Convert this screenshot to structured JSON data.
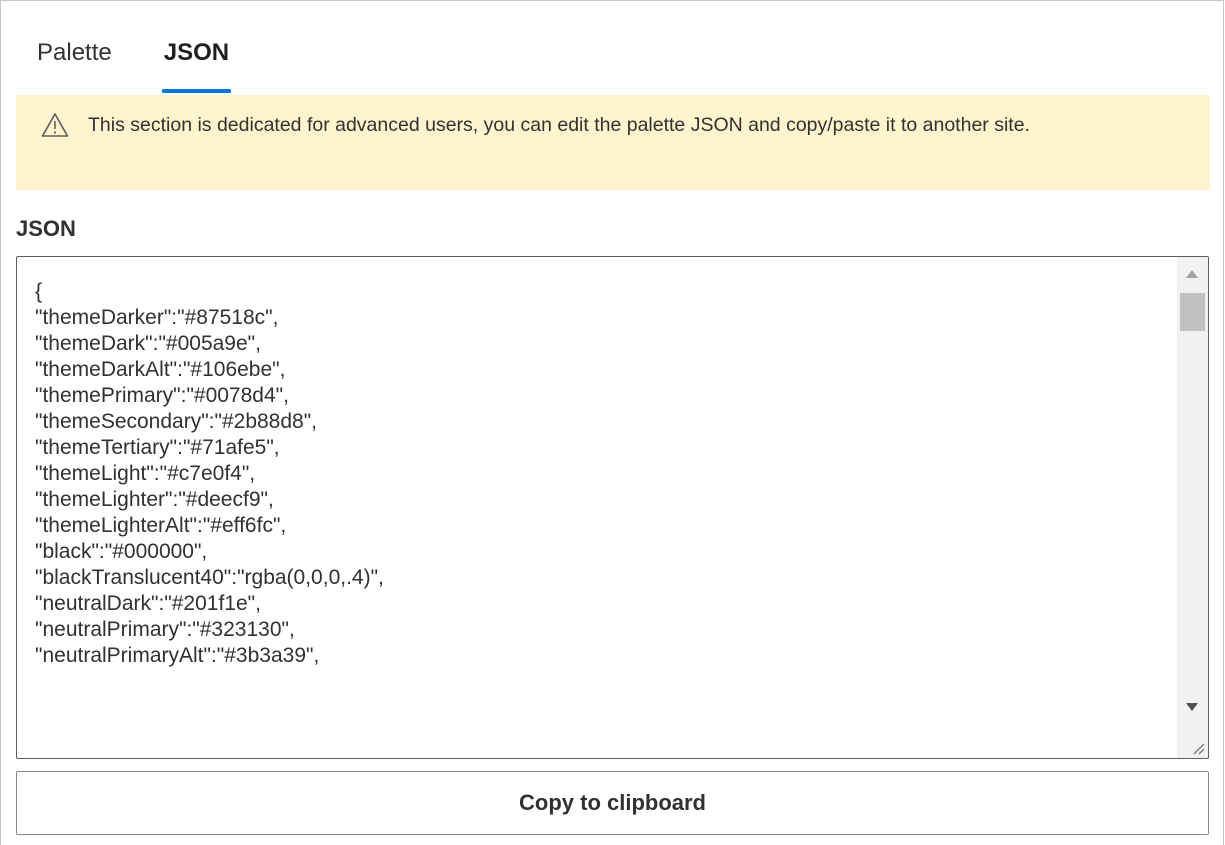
{
  "tabs": [
    {
      "label": "Palette",
      "active": false
    },
    {
      "label": "JSON",
      "active": true
    }
  ],
  "colors": {
    "accent": "#0078d4",
    "warning_bg": "#fff4ce",
    "text": "#323130"
  },
  "warning": {
    "icon": "warning-triangle-icon",
    "text": "This section is dedicated for advanced users, you can edit the palette JSON and copy/paste it to another site."
  },
  "json_field": {
    "label": "JSON",
    "value": "{\n\"themeDarker\":\"#87518c\",\n\"themeDark\":\"#005a9e\",\n\"themeDarkAlt\":\"#106ebe\",\n\"themePrimary\":\"#0078d4\",\n\"themeSecondary\":\"#2b88d8\",\n\"themeTertiary\":\"#71afe5\",\n\"themeLight\":\"#c7e0f4\",\n\"themeLighter\":\"#deecf9\",\n\"themeLighterAlt\":\"#eff6fc\",\n\"black\":\"#000000\",\n\"blackTranslucent40\":\"rgba(0,0,0,.4)\",\n\"neutralDark\":\"#201f1e\",\n\"neutralPrimary\":\"#323130\",\n\"neutralPrimaryAlt\":\"#3b3a39\","
  },
  "copy_button": {
    "label": "Copy to clipboard"
  }
}
